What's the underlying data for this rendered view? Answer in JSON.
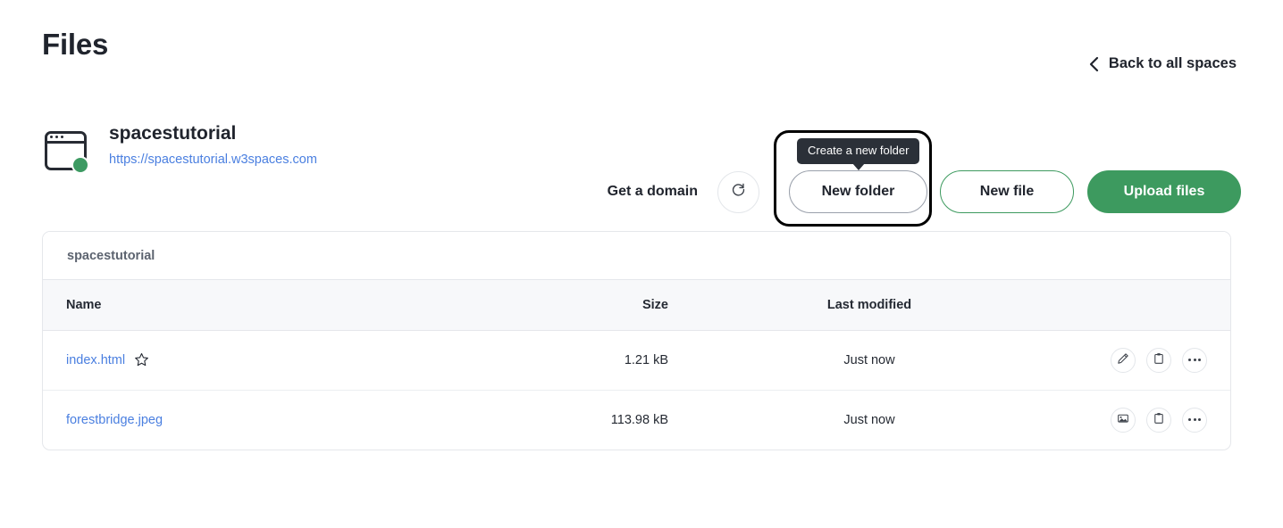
{
  "header": {
    "title": "Files",
    "back_label": "Back to all spaces",
    "back_icon": "chevron-left-icon"
  },
  "space": {
    "icon": "browser-window-icon",
    "status_color": "#3d9a62",
    "name": "spacestutorial",
    "url": "https://spacestutorial.w3spaces.com"
  },
  "actions": {
    "get_domain_label": "Get a domain",
    "refresh_icon": "refresh-icon",
    "new_folder_label": "New folder",
    "new_file_label": "New file",
    "upload_files_label": "Upload files",
    "accent_green": "#3d9a5f",
    "tooltip": {
      "text": "Create a new folder",
      "background": "#2b3038"
    }
  },
  "files_card": {
    "breadcrumb": "spacestutorial",
    "columns": [
      "Name",
      "Size",
      "Last modified"
    ],
    "rows": [
      {
        "name": "index.html",
        "starred": false,
        "star_icon": "star-outline-icon",
        "size": "1.21 kB",
        "modified": "Just now",
        "actions": [
          "pencil-icon",
          "clipboard-icon",
          "more-options-icon"
        ]
      },
      {
        "name": "forestbridge.jpeg",
        "starred": false,
        "star_icon": null,
        "size": "113.98 kB",
        "modified": "Just now",
        "actions": [
          "image-icon",
          "clipboard-icon",
          "more-options-icon"
        ]
      }
    ]
  }
}
